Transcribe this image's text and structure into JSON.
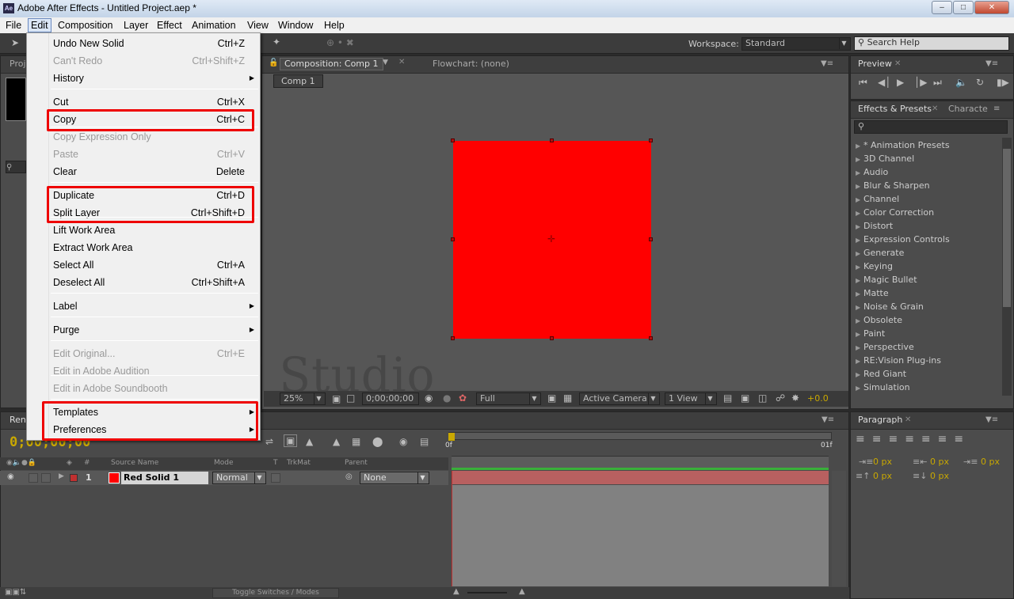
{
  "window": {
    "title": "Adobe After Effects - Untitled Project.aep *",
    "logo": "Ae"
  },
  "menubar": [
    "File",
    "Edit",
    "Composition",
    "Layer",
    "Effect",
    "Animation",
    "View",
    "Window",
    "Help"
  ],
  "toolbar": {
    "workspace_label": "Workspace:",
    "workspace_value": "Standard",
    "search_placeholder": "Search Help"
  },
  "project_panel": {
    "tab": "Proj"
  },
  "composition_panel": {
    "tab": "Composition: Comp 1",
    "flowchart_tab": "Flowchart: (none)",
    "breadcrumb": "Comp 1"
  },
  "viewer_bar": {
    "zoom": "25%",
    "timecode": "0;00;00;00",
    "resolution": "Full",
    "camera": "Active Camera",
    "views": "1 View",
    "exposure": "+0.0"
  },
  "preview_panel": {
    "tab": "Preview"
  },
  "effects_panel": {
    "tab": "Effects & Presets",
    "tab2": "Characte",
    "items": [
      "* Animation Presets",
      "3D Channel",
      "Audio",
      "Blur & Sharpen",
      "Channel",
      "Color Correction",
      "Distort",
      "Expression Controls",
      "Generate",
      "Keying",
      "Magic Bullet",
      "Matte",
      "Noise & Grain",
      "Obsolete",
      "Paint",
      "Perspective",
      "RE:Vision Plug-ins",
      "Red Giant",
      "Simulation"
    ]
  },
  "paragraph_panel": {
    "tab": "Paragraph",
    "values": [
      "0 px",
      "0 px",
      "0 px",
      "0 px",
      "0 px"
    ]
  },
  "timeline": {
    "tab": "Ren",
    "timecode": "0;00;00;00",
    "columns": {
      "num": "#",
      "source": "Source Name",
      "mode": "Mode",
      "t": "T",
      "trkmat": "TrkMat",
      "parent": "Parent"
    },
    "layer": {
      "index": "1",
      "name": "Red Solid 1",
      "mode": "Normal",
      "parent": "None",
      "color": "#ff0000"
    },
    "ruler": {
      "start": "0f",
      "end": "01f"
    },
    "toggle_label": "Toggle Switches / Modes"
  },
  "edit_menu": {
    "items": [
      {
        "label": "Undo New Solid",
        "shortcut": "Ctrl+Z"
      },
      {
        "label": "Can't Redo",
        "shortcut": "Ctrl+Shift+Z"
      },
      {
        "label": "History",
        "shortcut": ""
      },
      {
        "label": "Cut",
        "shortcut": "Ctrl+X"
      },
      {
        "label": "Copy",
        "shortcut": "Ctrl+C"
      },
      {
        "label": "Copy Expression Only",
        "shortcut": ""
      },
      {
        "label": "Paste",
        "shortcut": "Ctrl+V"
      },
      {
        "label": "Clear",
        "shortcut": "Delete"
      },
      {
        "label": "Duplicate",
        "shortcut": "Ctrl+D"
      },
      {
        "label": "Split Layer",
        "shortcut": "Ctrl+Shift+D"
      },
      {
        "label": "Lift Work Area",
        "shortcut": ""
      },
      {
        "label": "Extract Work Area",
        "shortcut": ""
      },
      {
        "label": "Select All",
        "shortcut": "Ctrl+A"
      },
      {
        "label": "Deselect All",
        "shortcut": "Ctrl+Shift+A"
      },
      {
        "label": "Label",
        "shortcut": ""
      },
      {
        "label": "Purge",
        "shortcut": ""
      },
      {
        "label": "Edit Original...",
        "shortcut": "Ctrl+E"
      },
      {
        "label": "Edit in Adobe Audition",
        "shortcut": ""
      },
      {
        "label": "Edit in Adobe Soundbooth",
        "shortcut": ""
      },
      {
        "label": "Templates",
        "shortcut": ""
      },
      {
        "label": "Preferences",
        "shortcut": ""
      }
    ]
  },
  "watermark": "NF Studio",
  "colors": {
    "solid": "#ff0000",
    "highlight": "#e00000",
    "timecode": "#c9a800"
  }
}
